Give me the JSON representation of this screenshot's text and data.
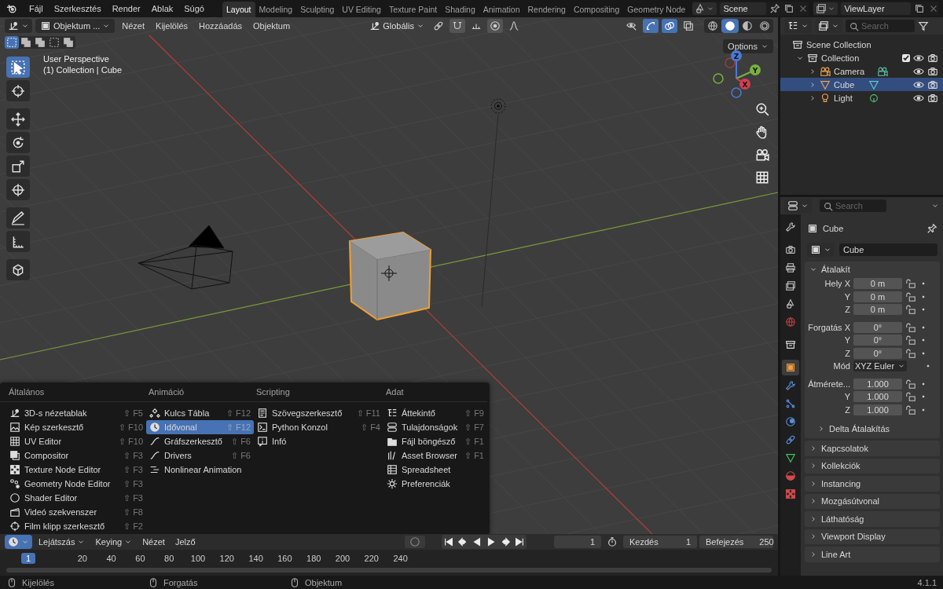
{
  "menubar": {
    "items": [
      "Fájl",
      "Szerkesztés",
      "Render",
      "Ablak",
      "Súgó"
    ]
  },
  "workspace_tabs": [
    {
      "label": "Layout",
      "selected": true
    },
    {
      "label": "Modeling",
      "selected": false
    },
    {
      "label": "Sculpting",
      "selected": false
    },
    {
      "label": "UV Editing",
      "selected": false
    },
    {
      "label": "Texture Paint",
      "selected": false
    },
    {
      "label": "Shading",
      "selected": false
    },
    {
      "label": "Animation",
      "selected": false
    },
    {
      "label": "Rendering",
      "selected": false
    },
    {
      "label": "Compositing",
      "selected": false
    },
    {
      "label": "Geometry Node",
      "selected": false
    }
  ],
  "scene": {
    "name": "Scene"
  },
  "view_layer": {
    "name": "ViewLayer"
  },
  "viewport": {
    "mode": "Objektum ...",
    "menus": [
      "Nézet",
      "Kijelölés",
      "Hozzáadás",
      "Objektum"
    ],
    "orientation": "Globális",
    "options": "Options",
    "info": [
      "User Perspective",
      "(1) Collection | Cube"
    ],
    "tool_toggles": [
      {
        "kind": "pivot",
        "on": false
      },
      {
        "kind": "snap",
        "on": true
      },
      {
        "kind": "increment",
        "on": false
      },
      {
        "kind": "proportional",
        "on": true
      },
      {
        "kind": "falloff",
        "on": false
      }
    ],
    "header_toggles": [
      {
        "kind": "visibility",
        "on": false
      },
      {
        "kind": "gizmo",
        "on": true
      },
      {
        "kind": "overlay",
        "on": true
      },
      {
        "kind": "xray",
        "on": false
      }
    ],
    "shading": [
      {
        "kind": "wireframe",
        "selected": false
      },
      {
        "kind": "solid",
        "selected": true
      },
      {
        "kind": "material",
        "selected": false
      },
      {
        "kind": "rendered",
        "selected": false
      }
    ],
    "select_modes": [
      {
        "kind": "set",
        "selected": true
      },
      {
        "kind": "extend",
        "selected": false
      },
      {
        "kind": "subtract",
        "selected": false
      },
      {
        "kind": "invert",
        "selected": false
      },
      {
        "kind": "intersect",
        "selected": false
      }
    ],
    "tools": [
      {
        "kind": "select",
        "selected": true
      },
      {
        "kind": "cursor",
        "selected": false
      },
      {
        "kind": "move",
        "selected": false
      },
      {
        "kind": "rotate",
        "selected": false
      },
      {
        "kind": "scale",
        "selected": false
      },
      {
        "kind": "transform",
        "selected": false
      },
      {
        "kind": "annotate",
        "selected": false
      },
      {
        "kind": "measure",
        "selected": false
      },
      {
        "kind": "add_cube",
        "selected": false
      }
    ],
    "nav": [
      {
        "kind": "zoom"
      },
      {
        "kind": "pan"
      },
      {
        "kind": "camera"
      },
      {
        "kind": "ortho"
      }
    ],
    "gizmo": {
      "x": "X",
      "y": "Y",
      "z": "Z"
    }
  },
  "editor_menu": {
    "columns": [
      {
        "title": "Általános",
        "items": [
          {
            "label": "3D-s nézetablak",
            "shortcut": "⇧ F5",
            "kind": "view3d",
            "selected": false
          },
          {
            "label": "Kép szerkesztő",
            "shortcut": "⇧ F10",
            "kind": "image",
            "selected": false
          },
          {
            "label": "UV Editor",
            "shortcut": "⇧ F10",
            "kind": "uv",
            "selected": false
          },
          {
            "label": "Compositor",
            "shortcut": "⇧ F3",
            "kind": "compositor",
            "selected": false
          },
          {
            "label": "Texture Node Editor",
            "shortcut": "⇧ F3",
            "kind": "texture",
            "selected": false
          },
          {
            "label": "Geometry Node Editor",
            "shortcut": "⇧ F3",
            "kind": "geometry",
            "selected": false
          },
          {
            "label": "Shader Editor",
            "shortcut": "⇧ F3",
            "kind": "shader",
            "selected": false
          },
          {
            "label": "Videó szekvenszer",
            "shortcut": "⇧ F8",
            "kind": "sequencer",
            "selected": false
          },
          {
            "label": "Film klipp szerkesztő",
            "shortcut": "⇧ F2",
            "kind": "clip",
            "selected": false
          }
        ]
      },
      {
        "title": "Animáció",
        "items": [
          {
            "label": "Kulcs Tábla",
            "shortcut": "⇧ F12",
            "kind": "dopesheet",
            "selected": false
          },
          {
            "label": "Idővonal",
            "shortcut": "⇧ F12",
            "kind": "timeline",
            "selected": true
          },
          {
            "label": "Gráfszerkesztő",
            "shortcut": "⇧ F6",
            "kind": "graph",
            "selected": false
          },
          {
            "label": "Drivers",
            "shortcut": "⇧ F6",
            "kind": "drivers",
            "selected": false
          },
          {
            "label": "Nonlinear Animation",
            "kind": "nla",
            "selected": false
          }
        ]
      },
      {
        "title": "Scripting",
        "items": [
          {
            "label": "Szövegszerkesztő",
            "shortcut": "⇧ F11",
            "kind": "text",
            "selected": false
          },
          {
            "label": "Python Konzol",
            "shortcut": "⇧ F4",
            "kind": "console",
            "selected": false
          },
          {
            "label": "Infó",
            "kind": "info",
            "selected": false
          }
        ]
      },
      {
        "title": "Adat",
        "items": [
          {
            "label": "Áttekintő",
            "shortcut": "⇧ F9",
            "kind": "outliner",
            "selected": false
          },
          {
            "label": "Tulajdonságok",
            "shortcut": "⇧ F7",
            "kind": "properties",
            "selected": false
          },
          {
            "label": "Fájl böngésző",
            "shortcut": "⇧ F1",
            "kind": "files",
            "selected": false
          },
          {
            "label": "Asset Browser",
            "shortcut": "⇧ F1",
            "kind": "assets",
            "selected": false
          },
          {
            "label": "Spreadsheet",
            "kind": "spreadsheet",
            "selected": false
          },
          {
            "label": "Preferenciák",
            "kind": "preferences",
            "selected": false
          }
        ]
      }
    ]
  },
  "timeline": {
    "menus": [
      {
        "label": "Lejátszás",
        "has_menu": true
      },
      {
        "label": "Keying",
        "has_menu": true
      },
      {
        "label": "Nézet",
        "has_menu": false
      },
      {
        "label": "Jelző",
        "has_menu": false
      }
    ],
    "current_frame": "1",
    "start_label": "Kezdés",
    "start": "1",
    "end_label": "Befejezés",
    "end": "250",
    "playhead": "1",
    "ticks": [
      "20",
      "40",
      "60",
      "80",
      "100",
      "120",
      "140",
      "160",
      "180",
      "200",
      "220",
      "240"
    ]
  },
  "outliner": {
    "search_placeholder": "Search",
    "tree": [
      {
        "label": "Scene Collection",
        "children": [
          {
            "label": "Collection",
            "expanded": true,
            "checked": true,
            "children": [
              {
                "label": "Camera",
                "kind": "camera",
                "expanded": false,
                "selected": false
              },
              {
                "label": "Cube",
                "kind": "mesh",
                "expanded": false,
                "selected": true
              },
              {
                "label": "Light",
                "kind": "light",
                "expanded": false,
                "selected": false
              }
            ]
          }
        ]
      }
    ]
  },
  "properties": {
    "search_placeholder": "Search",
    "tabs": [
      {
        "kind": "tool",
        "selected": false
      },
      {
        "kind": "render",
        "selected": false
      },
      {
        "kind": "output",
        "selected": false
      },
      {
        "kind": "view_layer",
        "selected": false
      },
      {
        "kind": "scene",
        "selected": false
      },
      {
        "kind": "world",
        "selected": false
      },
      {
        "kind": "collection",
        "selected": false
      },
      {
        "kind": "object",
        "selected": true
      },
      {
        "kind": "modifiers",
        "selected": false
      },
      {
        "kind": "particles",
        "selected": false
      },
      {
        "kind": "physics",
        "selected": false
      },
      {
        "kind": "constraints",
        "selected": false
      },
      {
        "kind": "data",
        "selected": false
      },
      {
        "kind": "material",
        "selected": false
      },
      {
        "kind": "texture",
        "selected": false
      }
    ],
    "object_name": "Cube",
    "data_name": "Cube",
    "transform": {
      "title": "Átalakít",
      "expanded": true,
      "groups": [
        {
          "rows": [
            {
              "label": "Hely X",
              "value": "0 m",
              "kind": "number"
            },
            {
              "label": "Y",
              "value": "0 m",
              "kind": "number"
            },
            {
              "label": "Z",
              "value": "0 m",
              "kind": "number"
            }
          ]
        },
        {
          "rows": [
            {
              "label": "Forgatás X",
              "value": "0°",
              "kind": "number"
            },
            {
              "label": "Y",
              "value": "0°",
              "kind": "number"
            },
            {
              "label": "Z",
              "value": "0°",
              "kind": "number"
            },
            {
              "label": "Mód",
              "value": "XYZ Euler",
              "kind": "dropdown"
            }
          ]
        },
        {
          "rows": [
            {
              "label": "Átmérete...",
              "value": "1.000",
              "kind": "number"
            },
            {
              "label": "Y",
              "value": "1.000",
              "kind": "number"
            },
            {
              "label": "Z",
              "value": "1.000",
              "kind": "number"
            }
          ]
        }
      ],
      "subpanel": {
        "title": "Delta Átalakítás",
        "expanded": false
      }
    },
    "panels": [
      {
        "title": "Kapcsolatok",
        "expanded": false
      },
      {
        "title": "Kollekciók",
        "expanded": false
      },
      {
        "title": "Instancing",
        "expanded": false
      },
      {
        "title": "Mozgásútvonal",
        "expanded": false
      },
      {
        "title": "Láthatóság",
        "expanded": false
      },
      {
        "title": "Viewport Display",
        "expanded": false
      },
      {
        "title": "Line Art",
        "expanded": false
      }
    ]
  },
  "status_bar": {
    "items": [
      "Kijelölés",
      "Forgatás",
      "Objektum"
    ],
    "version": "4.1.1"
  }
}
